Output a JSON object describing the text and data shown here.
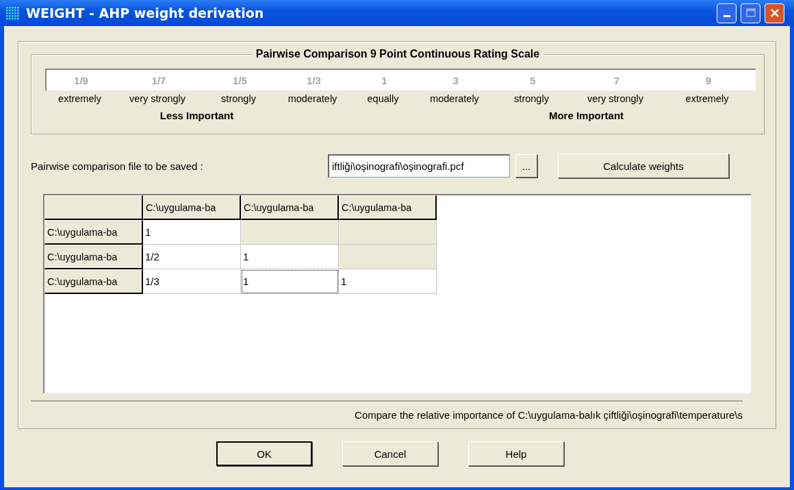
{
  "window": {
    "title": "WEIGHT - AHP weight derivation"
  },
  "scale": {
    "title": "Pairwise Comparison 9 Point Continuous Rating Scale",
    "points": [
      {
        "value": "1/9",
        "label": "extremely"
      },
      {
        "value": "1/7",
        "label": "very strongly"
      },
      {
        "value": "1/5",
        "label": "strongly"
      },
      {
        "value": "1/3",
        "label": "moderately"
      },
      {
        "value": "1",
        "label": "equally"
      },
      {
        "value": "3",
        "label": "moderately"
      },
      {
        "value": "5",
        "label": "strongly"
      },
      {
        "value": "7",
        "label": "very strongly"
      },
      {
        "value": "9",
        "label": "extremely"
      }
    ],
    "less_label": "Less Important",
    "more_label": "More Important"
  },
  "file": {
    "label": "Pairwise comparison file to be saved :",
    "value": "iftliği\\oşinografi\\oşinografi.pcf",
    "browse": "...",
    "calculate": "Calculate weights"
  },
  "matrix": {
    "columns": [
      "C:\\uygulama-ba",
      "C:\\uygulama-ba",
      "C:\\uygulama-ba"
    ],
    "rows": [
      {
        "header": "C:\\uygulama-ba",
        "cells": [
          {
            "kind": "value",
            "value": "1",
            "focused": false
          },
          {
            "kind": "blank",
            "focused": false
          },
          {
            "kind": "blank",
            "focused": false
          }
        ]
      },
      {
        "header": "C:\\uygulama-ba",
        "cells": [
          {
            "kind": "value",
            "value": "1/2",
            "focused": false
          },
          {
            "kind": "value",
            "value": "1",
            "focused": false
          },
          {
            "kind": "blank",
            "focused": false
          }
        ]
      },
      {
        "header": "C:\\uygulama-ba",
        "cells": [
          {
            "kind": "value",
            "value": "1/3",
            "focused": false
          },
          {
            "kind": "value",
            "value": "1",
            "focused": true
          },
          {
            "kind": "value",
            "value": "1",
            "focused": false
          }
        ]
      }
    ]
  },
  "status_bar": "Compare the relative importance of C:\\uygulama-balık çiftliği\\oşinografi\\temperature\\s",
  "buttons": [
    {
      "label": "OK",
      "default": true
    },
    {
      "label": "Cancel",
      "default": false
    },
    {
      "label": "Help",
      "default": false
    }
  ]
}
